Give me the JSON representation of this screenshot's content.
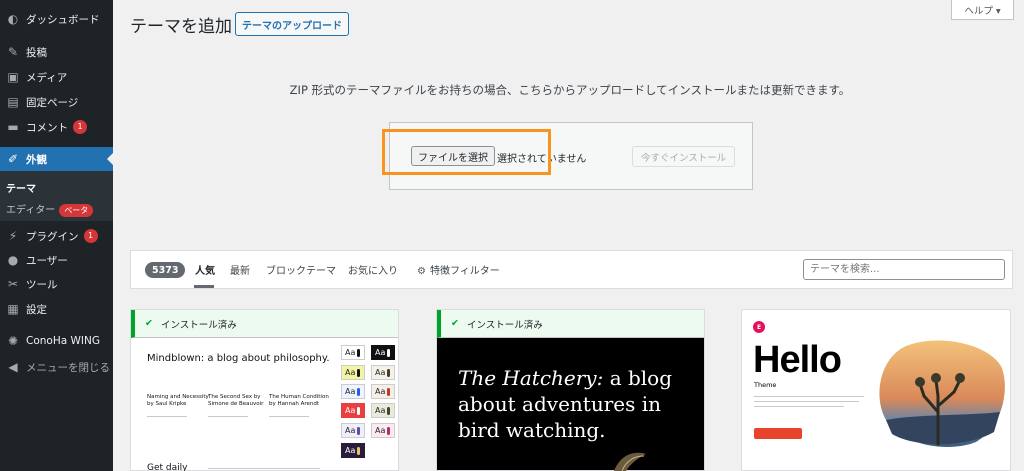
{
  "sidebar": {
    "items": [
      {
        "label": "ダッシュボード",
        "icon": "dashboard-icon",
        "glyph": "◐"
      },
      {
        "label": "投稿",
        "icon": "pin-icon",
        "glyph": "✎"
      },
      {
        "label": "メディア",
        "icon": "media-icon",
        "glyph": "▣"
      },
      {
        "label": "固定ページ",
        "icon": "page-icon",
        "glyph": "▤"
      },
      {
        "label": "コメント",
        "icon": "comment-icon",
        "glyph": "▬",
        "badge": "1"
      },
      {
        "label": "外観",
        "icon": "appearance-icon",
        "glyph": "✐"
      },
      {
        "label": "プラグイン",
        "icon": "plugin-icon",
        "glyph": "⚡",
        "badge": "1"
      },
      {
        "label": "ユーザー",
        "icon": "user-icon",
        "glyph": "●"
      },
      {
        "label": "ツール",
        "icon": "tool-icon",
        "glyph": "✂"
      },
      {
        "label": "設定",
        "icon": "settings-icon",
        "glyph": "▦"
      },
      {
        "label": "ConoHa WING",
        "icon": "conoha-icon",
        "glyph": "✺"
      },
      {
        "label": "メニューを閉じる",
        "icon": "collapse-icon",
        "glyph": "◀"
      }
    ],
    "submenu": {
      "themes": "テーマ",
      "editor": "エディター",
      "beta": "ベータ"
    }
  },
  "header": {
    "title": "テーマを追加",
    "upload_button": "テーマのアップロード",
    "help": "ヘルプ ▾"
  },
  "upload": {
    "description": "ZIP 形式のテーマファイルをお持ちの場合、こちらからアップロードしてインストールまたは更新できます。",
    "choose_file": "ファイルを選択",
    "file_status": "選択されていません",
    "install_now": "今すぐインストール"
  },
  "filters": {
    "count": "5373",
    "tabs": [
      "人気",
      "最新",
      "ブロックテーマ",
      "お気に入り"
    ],
    "feature_filter": "特徴フィルター",
    "search_placeholder": "テーマを検索..."
  },
  "themes": [
    {
      "installed_label": "インストール済み",
      "headline": "Mindblown: a blog about philosophy.",
      "books": [
        {
          "title": "Naming and Necessity",
          "author": "by Saul Kripke"
        },
        {
          "title": "The Second Sex by",
          "author": "Simone de Beauvoir"
        },
        {
          "title": "The Human Condition",
          "author": "by Hannah Arendt"
        }
      ],
      "footer": "Get daily"
    },
    {
      "installed_label": "インストール済み",
      "headline_em": "The Hatchery:",
      "headline_rest": " a blog about adventures in bird watching."
    },
    {
      "title": "Hello",
      "subtitle": "Theme",
      "logo": "E"
    }
  ],
  "colors": {
    "accent": "#2271b1",
    "sidebar": "#1d2327",
    "highlight": "#f7941d",
    "installed": "#00a32a",
    "badge": "#d63638"
  }
}
